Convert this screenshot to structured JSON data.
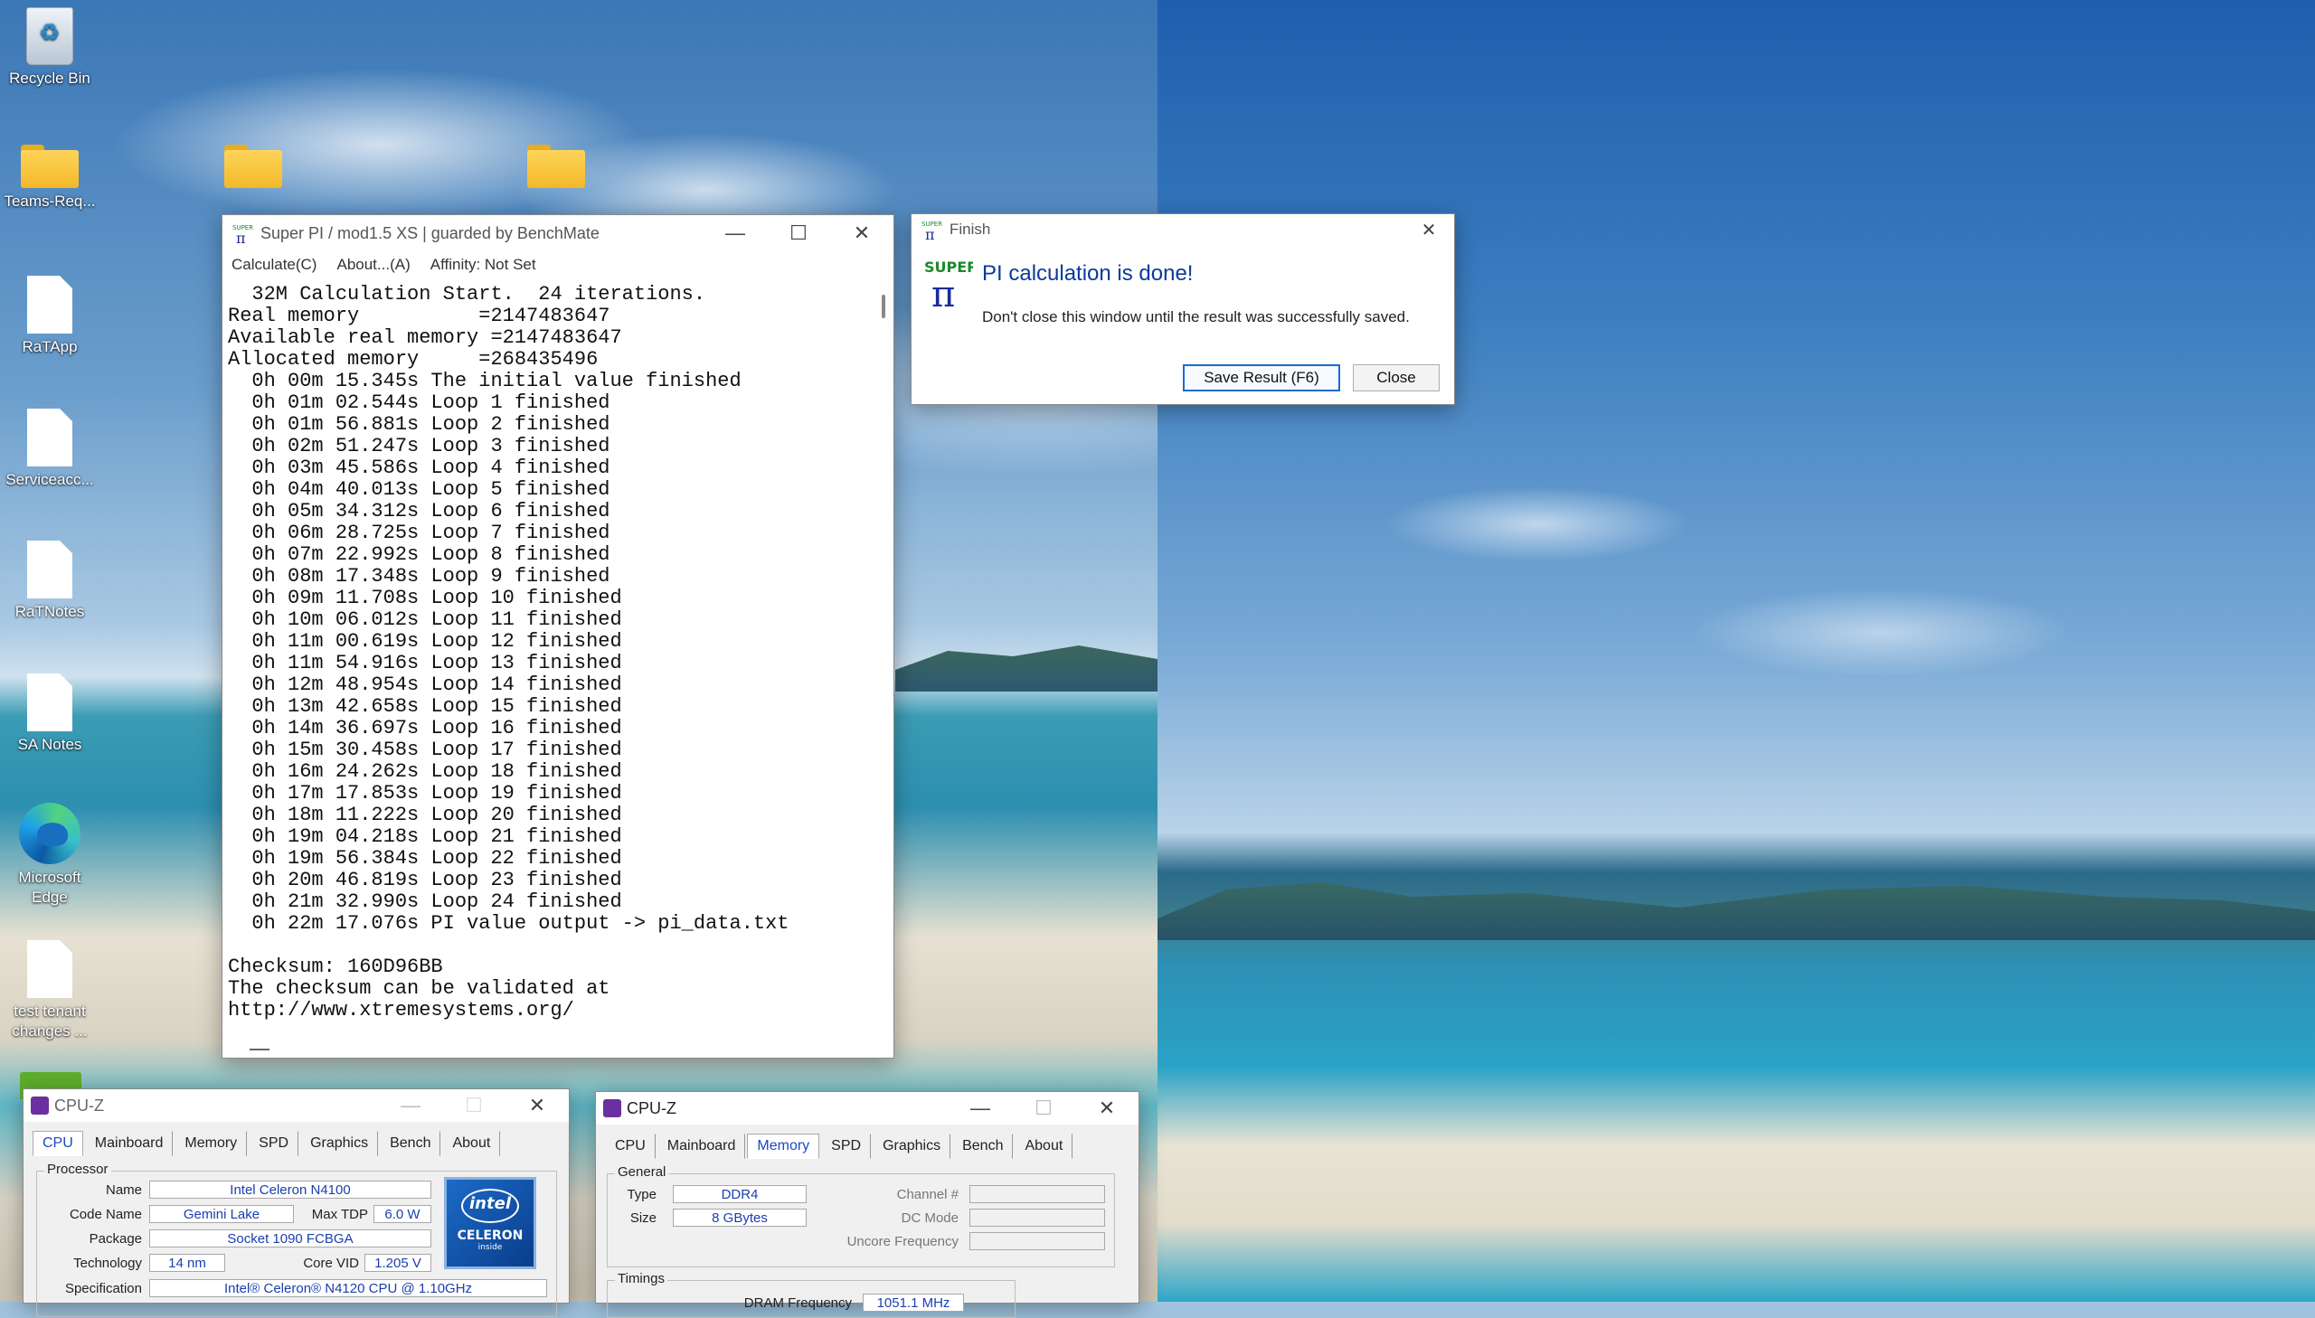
{
  "desktop": {
    "icons": [
      {
        "label": "Recycle Bin"
      },
      {
        "label": "Teams-Req..."
      },
      {
        "label": "RaTApp"
      },
      {
        "label": "Serviceacc..."
      },
      {
        "label": "RaTNotes"
      },
      {
        "label": "SA Notes"
      },
      {
        "label": "Microsoft Edge"
      },
      {
        "label": "test tenant changes ..."
      }
    ]
  },
  "superpi": {
    "title": "Super PI / mod1.5 XS | guarded by BenchMate",
    "menu": [
      "Calculate(C)",
      "About...(A)",
      "Affinity: Not Set"
    ],
    "lines": [
      "  32M Calculation Start.  24 iterations.",
      "Real memory          =2147483647",
      "Available real memory =2147483647",
      "Allocated memory     =268435496",
      "  0h 00m 15.345s The initial value finished",
      "  0h 01m 02.544s Loop 1 finished",
      "  0h 01m 56.881s Loop 2 finished",
      "  0h 02m 51.247s Loop 3 finished",
      "  0h 03m 45.586s Loop 4 finished",
      "  0h 04m 40.013s Loop 5 finished",
      "  0h 05m 34.312s Loop 6 finished",
      "  0h 06m 28.725s Loop 7 finished",
      "  0h 07m 22.992s Loop 8 finished",
      "  0h 08m 17.348s Loop 9 finished",
      "  0h 09m 11.708s Loop 10 finished",
      "  0h 10m 06.012s Loop 11 finished",
      "  0h 11m 00.619s Loop 12 finished",
      "  0h 11m 54.916s Loop 13 finished",
      "  0h 12m 48.954s Loop 14 finished",
      "  0h 13m 42.658s Loop 15 finished",
      "  0h 14m 36.697s Loop 16 finished",
      "  0h 15m 30.458s Loop 17 finished",
      "  0h 16m 24.262s Loop 18 finished",
      "  0h 17m 17.853s Loop 19 finished",
      "  0h 18m 11.222s Loop 20 finished",
      "  0h 19m 04.218s Loop 21 finished",
      "  0h 19m 56.384s Loop 22 finished",
      "  0h 20m 46.819s Loop 23 finished",
      "  0h 21m 32.990s Loop 24 finished",
      "  0h 22m 17.076s PI value output -> pi_data.txt",
      "",
      "Checksum: 160D96BB",
      "The checksum can be validated at",
      "http://www.xtremesystems.org/"
    ]
  },
  "finish": {
    "title": "Finish",
    "heading": "PI calculation is done!",
    "message": "Don't close this window until the result was successfully saved.",
    "save_label": "Save Result (F6)",
    "close_label": "Close"
  },
  "cpuz_cpu": {
    "title": "CPU-Z",
    "tabs": [
      "CPU",
      "Mainboard",
      "Memory",
      "SPD",
      "Graphics",
      "Bench",
      "About"
    ],
    "active_tab": "CPU",
    "processor_group": "Processor",
    "name_label": "Name",
    "name_value": "Intel Celeron N4100",
    "codename_label": "Code Name",
    "codename_value": "Gemini Lake",
    "maxtdp_label": "Max TDP",
    "maxtdp_value": "6.0 W",
    "package_label": "Package",
    "package_value": "Socket 1090 FCBGA",
    "technology_label": "Technology",
    "technology_value": "14 nm",
    "corevid_label": "Core VID",
    "corevid_value": "1.205 V",
    "spec_label": "Specification",
    "spec_value": "Intel® Celeron® N4120 CPU @ 1.10GHz",
    "logo_brand": "intel",
    "logo_name": "CELERON",
    "logo_inside": "inside"
  },
  "cpuz_mem": {
    "title": "CPU-Z",
    "tabs": [
      "CPU",
      "Mainboard",
      "Memory",
      "SPD",
      "Graphics",
      "Bench",
      "About"
    ],
    "active_tab": "Memory",
    "general_group": "General",
    "type_label": "Type",
    "type_value": "DDR4",
    "size_label": "Size",
    "size_value": "8 GBytes",
    "channel_label": "Channel #",
    "dcmode_label": "DC Mode",
    "uncore_label": "Uncore Frequency",
    "timings_group": "Timings",
    "dram_label": "DRAM Frequency",
    "dram_value": "1051.1 MHz"
  }
}
